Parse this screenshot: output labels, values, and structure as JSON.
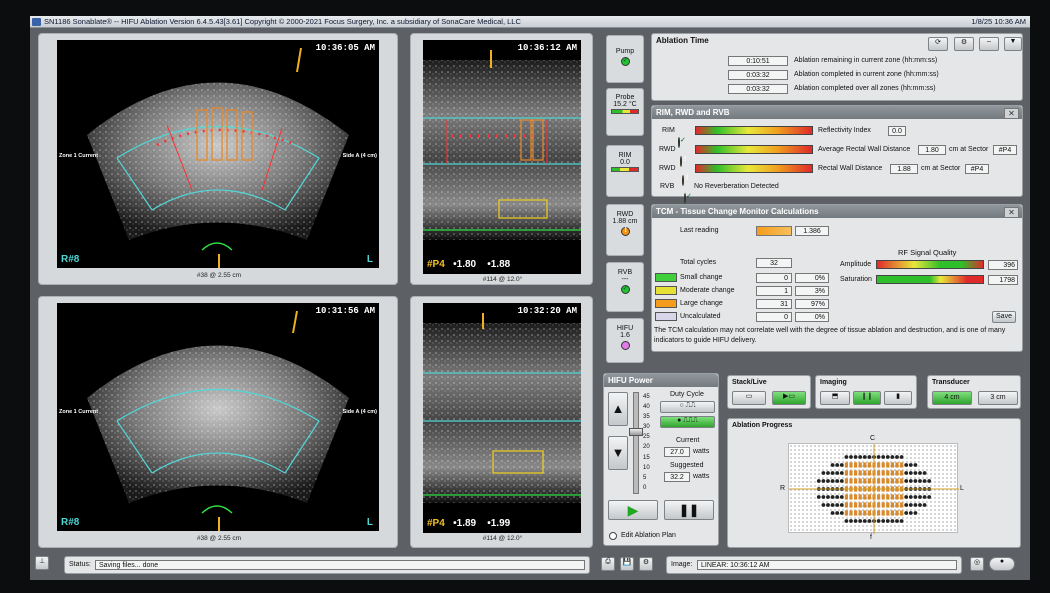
{
  "app": {
    "title": "SN1186 Sonablate® -- HIFU Ablation Version 6.4.5.43[3.61] Copyright © 2000-2021 Focus Surgery, Inc. a subsidiary of SonaCare Medical, LLC",
    "datetime": "1/8/25  10:36 AM"
  },
  "views": {
    "tl": {
      "time": "10:36:05 AM",
      "zone": "Zone 1 Current",
      "side": "Side A (4 cm)",
      "sector": "R#8",
      "l": "L",
      "caption": "#38 @ 2.55 cm"
    },
    "tr": {
      "time": "10:36:12 AM",
      "sector": "#P4",
      "r1": "•1.80",
      "r2": "•1.88",
      "caption": "#114 @ 12.0°"
    },
    "bl": {
      "time": "10:31:56 AM",
      "zone": "Zone 1 Current",
      "side": "Side A (4 cm)",
      "sector": "R#8",
      "l": "L",
      "caption": "#38 @ 2.55 cm"
    },
    "br": {
      "time": "10:32:20 AM",
      "sector": "#P4",
      "r1": "•1.89",
      "r2": "•1.99",
      "caption": "#114 @ 12.0°"
    }
  },
  "status_col": {
    "pump": "Pump",
    "probe": "Probe",
    "probe_temp": "15.2 °C",
    "rim": "RIM",
    "rim_val": "0.0",
    "rwd": "RWD",
    "rwd_val": "1.88 cm",
    "rvb": "RVB",
    "rvb_val": "---",
    "hifu": "HIFU",
    "hifu_val": "1.6"
  },
  "ablation_time": {
    "title": "Ablation Time",
    "rows": [
      {
        "value": "0:10:51",
        "label": "Ablation remaining in current zone (hh:mm:ss)"
      },
      {
        "value": "0:03:32",
        "label": "Ablation completed in current zone (hh:mm:ss)"
      },
      {
        "value": "0:03:32",
        "label": "Ablation completed over all zones (hh:mm:ss)"
      }
    ]
  },
  "rim_panel": {
    "title": "RIM, RWD and RVB",
    "rim": "RIM",
    "rwd": "RWD",
    "rvb": "RVB",
    "refl_label": "Reflectivity Index",
    "refl_value": "0.0",
    "avg_label": "Average Rectal Wall Distance",
    "avg_value": "1.80",
    "avg_unit": "cm at Sector",
    "avg_sector": "#P4",
    "rwd_label": "Rectal Wall Distance",
    "rwd_value": "1.88",
    "rwd_unit": "cm at Sector",
    "rwd_sector": "#P4",
    "rvb_text": "No Reverberation Detected"
  },
  "tcm": {
    "title": "TCM - Tissue Change Monitor Calculations",
    "last_reading": "Last reading",
    "last_value": "1.386",
    "total_cycles": "Total cycles",
    "total_value": "32",
    "rows": [
      {
        "label": "Small change",
        "count": "0",
        "pct": "0%",
        "color": "#3fcf3a"
      },
      {
        "label": "Moderate change",
        "count": "1",
        "pct": "3%",
        "color": "#e6e235"
      },
      {
        "label": "Large change",
        "count": "31",
        "pct": "97%",
        "color": "#f59c1c"
      },
      {
        "label": "Uncalculated",
        "count": "0",
        "pct": "0%",
        "color": "#d8d4ea"
      }
    ],
    "rf_title": "RF Signal Quality",
    "amplitude": "Amplitude",
    "amplitude_value": "396",
    "saturation": "Saturation",
    "saturation_value": "1798",
    "save": "Save",
    "note": "The TCM calculation may not correlate well with the degree of tissue ablation and destruction, and is one of many indicators to guide HIFU delivery."
  },
  "hifu_power": {
    "title": "HIFU Power",
    "scale": [
      "45",
      "40",
      "35",
      "30",
      "25",
      "20",
      "15",
      "10",
      "5",
      "0"
    ],
    "duty_cycle": "Duty Cycle",
    "current": "Current",
    "current_value": "27.0",
    "current_unit": "watts",
    "suggested": "Suggested",
    "suggested_value": "32.2",
    "suggested_unit": "watts",
    "edit_plan": "Edit Ablation Plan",
    "power_level": 0.62
  },
  "stack_live": {
    "title": "Stack/Live"
  },
  "imaging": {
    "title": "Imaging"
  },
  "transducer": {
    "title": "Transducer",
    "opt1": "4 cm",
    "opt2": "3 cm"
  },
  "ablation_progress": {
    "title": "Ablation Progress",
    "top": "C",
    "left": "R",
    "right": "L",
    "bottom": "f"
  },
  "footer": {
    "status_label": "Status:",
    "status_value": "Saving files... done",
    "image_label": "Image:",
    "image_value": "LINEAR: 10:36:12 AM"
  }
}
